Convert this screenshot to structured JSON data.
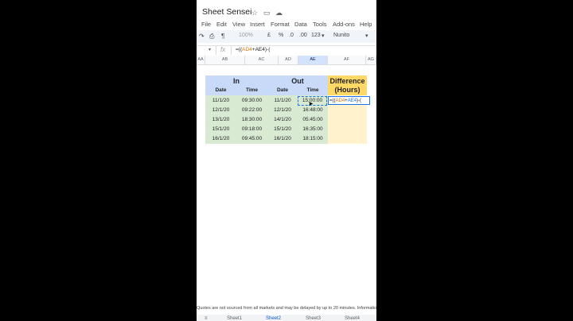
{
  "app": {
    "title": "Sheet Sensei"
  },
  "menu": [
    "File",
    "Edit",
    "View",
    "Insert",
    "Format",
    "Data",
    "Tools",
    "Add-ons",
    "Help"
  ],
  "toolbar": {
    "zoom": "100%",
    "currency": "£",
    "percent": "%",
    "dec_decrease": ".0",
    "dec_increase": ".00",
    "number_format": "123",
    "font": "Nunito"
  },
  "formula_bar": {
    "cell_ref": "",
    "fx": "fx",
    "formula_prefix": "=((",
    "formula_ref1": "AD4",
    "formula_plus": "+",
    "formula_ref2": "AE4",
    "formula_suffix": ")-("
  },
  "columns": [
    "AA",
    "AB",
    "AC",
    "AD",
    "AE",
    "AF",
    "AG"
  ],
  "sheet": {
    "in_header": "In",
    "out_header": "Out",
    "diff_header_1": "Difference",
    "diff_header_2": "(Hours)",
    "sub_headers": [
      "Date",
      "Time",
      "Date",
      "Time"
    ],
    "rows": [
      [
        "11/1/20",
        "09:30:00",
        "11/1/20",
        "15:00:00"
      ],
      [
        "12/1/20",
        "09:22:00",
        "12/1/20",
        "16:48:00"
      ],
      [
        "13/1/20",
        "18:30:00",
        "14/1/20",
        "05:45:00"
      ],
      [
        "15/1/20",
        "09:18:00",
        "15/1/20",
        "16:35:00"
      ],
      [
        "16/1/20",
        "09:45:00",
        "16/1/20",
        "18:15:00"
      ]
    ]
  },
  "ticker": "Quotes are not sourced from all markets and may be delayed by up to 20 minutes. Information",
  "tabs": [
    "Sheet1",
    "Sheet2",
    "Sheet3",
    "Sheet4"
  ]
}
